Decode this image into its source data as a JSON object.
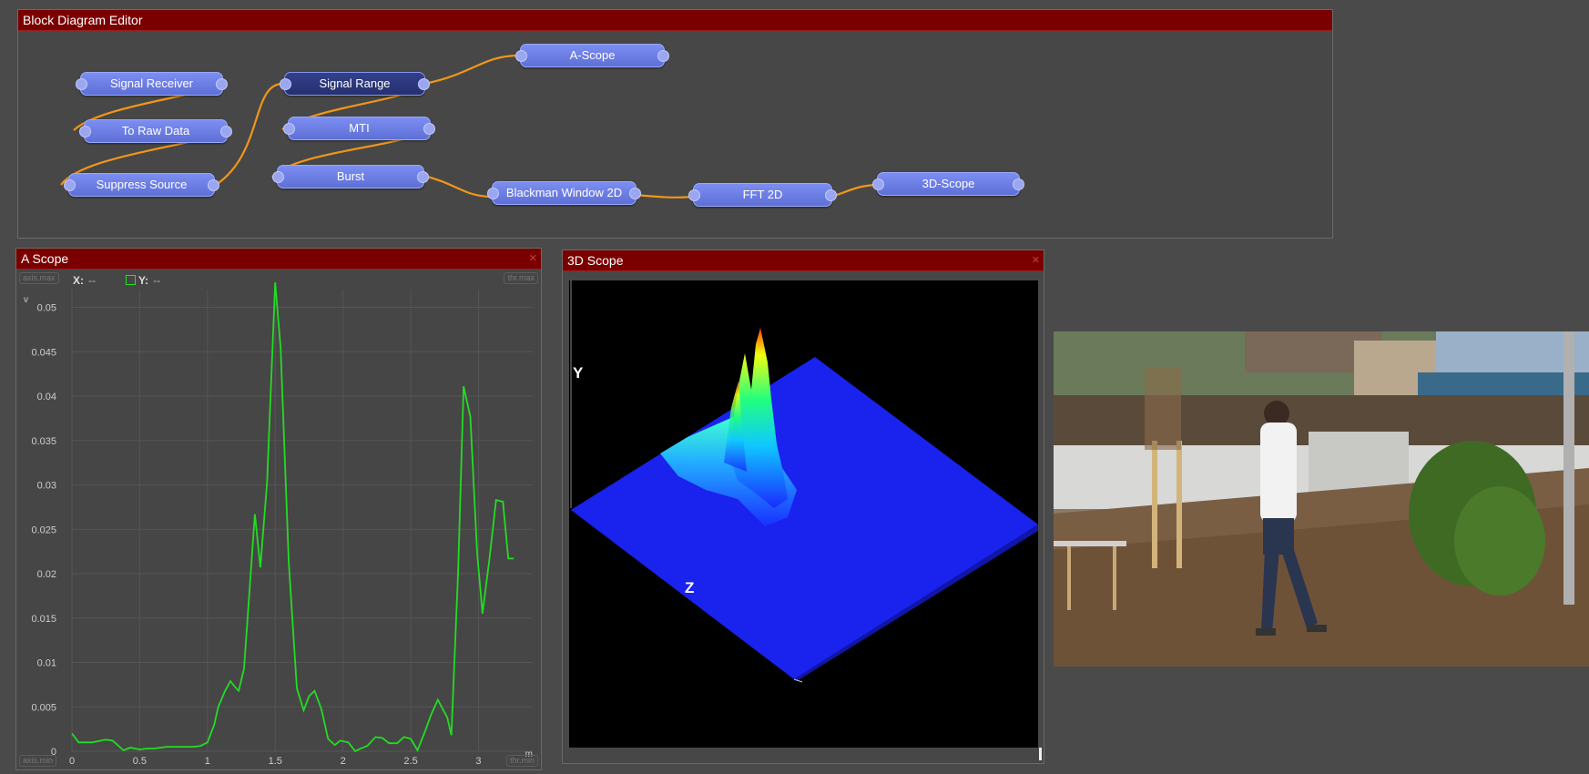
{
  "block_editor": {
    "title": "Block Diagram Editor",
    "nodes": {
      "signal_receiver": "Signal Receiver",
      "to_raw_data": "To Raw Data",
      "suppress_source": "Suppress Source",
      "signal_range": "Signal Range",
      "mti": "MTI",
      "burst": "Burst",
      "a_scope": "A-Scope",
      "blackman": "Blackman Window 2D",
      "fft": "FFT 2D",
      "scope3d": "3D-Scope"
    }
  },
  "a_scope": {
    "title": "A Scope",
    "axis_max": "axis.max",
    "axis_min": "axis.min",
    "thr_max": "thr.max",
    "thr_min": "thr.min",
    "x_label": "X:",
    "x_value": "--",
    "y_label": "Y:",
    "y_value": "--",
    "series_color": "#22dd22"
  },
  "chart_data": {
    "type": "line",
    "xlabel": "m",
    "ylabel": "v",
    "xlim": [
      0,
      3.4
    ],
    "ylim": [
      0,
      0.052
    ],
    "xticks": [
      "0",
      "0.5",
      "1",
      "1.5",
      "2",
      "2.5",
      "3"
    ],
    "yticks": [
      "0",
      "0.005",
      "0.01",
      "0.015",
      "0.02",
      "0.025",
      "0.03",
      "0.035",
      "0.04",
      "0.045",
      "0.05"
    ],
    "series": [
      {
        "x": [
          0,
          0.05,
          0.15,
          0.25,
          0.3,
          0.38,
          0.43,
          0.5,
          0.55,
          0.6,
          0.7,
          0.8,
          0.9,
          0.95,
          1.0,
          1.05,
          1.08,
          1.13,
          1.17,
          1.2,
          1.23,
          1.27,
          1.35,
          1.39,
          1.44,
          1.5,
          1.54,
          1.6,
          1.66,
          1.71,
          1.75,
          1.79,
          1.84,
          1.89,
          1.94,
          1.98,
          2.04,
          2.09,
          2.13,
          2.18,
          2.24,
          2.29,
          2.34,
          2.4,
          2.45,
          2.5,
          2.55,
          2.6,
          2.65,
          2.7,
          2.77,
          2.8,
          2.85,
          2.89,
          2.94,
          2.99,
          3.03,
          3.08,
          3.13,
          3.18,
          3.22,
          3.26
        ],
        "y": [
          0.002,
          0.001,
          0.001,
          0.0013,
          0.0012,
          0.0001,
          0.0004,
          0.0002,
          0.0003,
          0.0003,
          0.0005,
          0.0005,
          0.0005,
          0.0006,
          0.001,
          0.003,
          0.005,
          0.0068,
          0.0079,
          0.0073,
          0.0068,
          0.0093,
          0.0267,
          0.0207,
          0.0303,
          0.0528,
          0.0454,
          0.0213,
          0.0071,
          0.0046,
          0.0062,
          0.0068,
          0.0048,
          0.0014,
          0.0007,
          0.0012,
          0.001,
          0.0,
          0.0003,
          0.0006,
          0.0016,
          0.0015,
          0.0009,
          0.0009,
          0.0016,
          0.0014,
          0.0001,
          0.002,
          0.0041,
          0.0058,
          0.0038,
          0.0018,
          0.0202,
          0.0411,
          0.0377,
          0.0223,
          0.0155,
          0.0216,
          0.0283,
          0.0281,
          0.0217,
          0.0217
        ],
        "color": "#22dd22"
      }
    ],
    "grid": true
  },
  "scope3d": {
    "title": "3D Scope",
    "axis_y": "Y",
    "axis_z": "Z"
  }
}
